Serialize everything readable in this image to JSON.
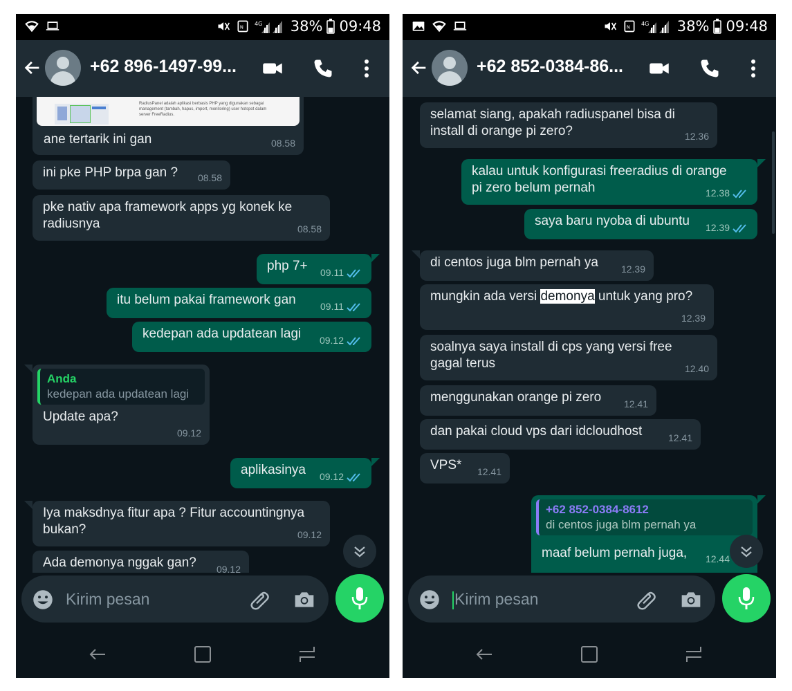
{
  "left": {
    "status": {
      "battery": "38%",
      "time": "09:48"
    },
    "header": {
      "title": "+62 896-1497-99..."
    },
    "messages": [
      {
        "text": "ane tertarik ini gan",
        "time": "08.58"
      },
      {
        "text": "ini pke PHP brpa gan ?",
        "time": "08.58"
      },
      {
        "line1": "pke nativ apa framework apps yg konek ke",
        "line2": "radiusnya",
        "time": "08.58"
      },
      {
        "text": "php 7+",
        "time": "09.11"
      },
      {
        "text": "itu belum pakai framework gan",
        "time": "09.11"
      },
      {
        "text": "kedepan ada updatean lagi",
        "time": "09.12"
      },
      {
        "reply_author": "Anda",
        "reply_text": "kedepan ada updatean lagi",
        "text": "Update apa?",
        "time": "09.12"
      },
      {
        "text": "aplikasinya",
        "time": "09.12"
      },
      {
        "line1": "Iya maksdnya fitur apa ? Fitur accountingnya",
        "line2": "bukan?",
        "time": "09.12"
      },
      {
        "text": "Ada demonya nggak gan?",
        "time": "09.12"
      }
    ],
    "preview_snippet": [
      "RadiusPanel adalah aplikasi berbasis PHP yang digunakan sebagai",
      "management (tambah, hapus, import, monitoring) user hotspot dalam",
      "server FreeRadius."
    ],
    "input": {
      "placeholder": "Kirim pesan"
    }
  },
  "right": {
    "status": {
      "battery": "38%",
      "time": "09:48"
    },
    "header": {
      "title": "+62 852-0384-86..."
    },
    "messages": [
      {
        "line1": "selamat siang, apakah radiuspanel bisa di",
        "line2": "install di orange pi zero?",
        "time": "12.36"
      },
      {
        "line1": "kalau untuk konfigurasi freeradius di orange",
        "line2": "pi zero belum pernah",
        "time": "12.38"
      },
      {
        "text": "saya baru nyoba di ubuntu",
        "time": "12.39"
      },
      {
        "text": "di centos juga blm pernah ya",
        "time": "12.39"
      },
      {
        "pre": "mungkin ada versi ",
        "highlight": "demonya",
        "post": " untuk yang pro?",
        "time": "12.39"
      },
      {
        "line1": "soalnya saya install di cps yang versi free",
        "line2": "gagal terus",
        "time": "12.40"
      },
      {
        "text": "menggunakan orange pi zero",
        "time": "12.41"
      },
      {
        "text": "dan pakai cloud vps dari idcloudhost",
        "time": "12.41"
      },
      {
        "text": "VPS*",
        "time": "12.41"
      },
      {
        "reply_author": "+62 852-0384-8612",
        "reply_text": "di centos juga blm pernah ya",
        "text": "maaf belum pernah juga,",
        "time": "12.44"
      }
    ],
    "input": {
      "placeholder": "Kirim pesan"
    }
  },
  "colors": {
    "bg": "#0b141a",
    "bar": "#1f2c34",
    "incoming": "#1f2c34",
    "outgoing": "#005c4b",
    "accent": "#25d366",
    "tick": "#53bdeb"
  },
  "icons": [
    "wifi-icon",
    "laptop-icon",
    "image-icon",
    "mute-icon",
    "nfc-icon",
    "signal-icon",
    "battery-icon",
    "back-arrow-icon",
    "avatar-icon",
    "video-call-icon",
    "voice-call-icon",
    "more-menu-icon",
    "emoji-icon",
    "attach-icon",
    "camera-icon",
    "mic-icon",
    "nav-back-icon",
    "nav-home-icon",
    "nav-recents-icon",
    "scroll-down-icon",
    "double-tick-icon"
  ]
}
